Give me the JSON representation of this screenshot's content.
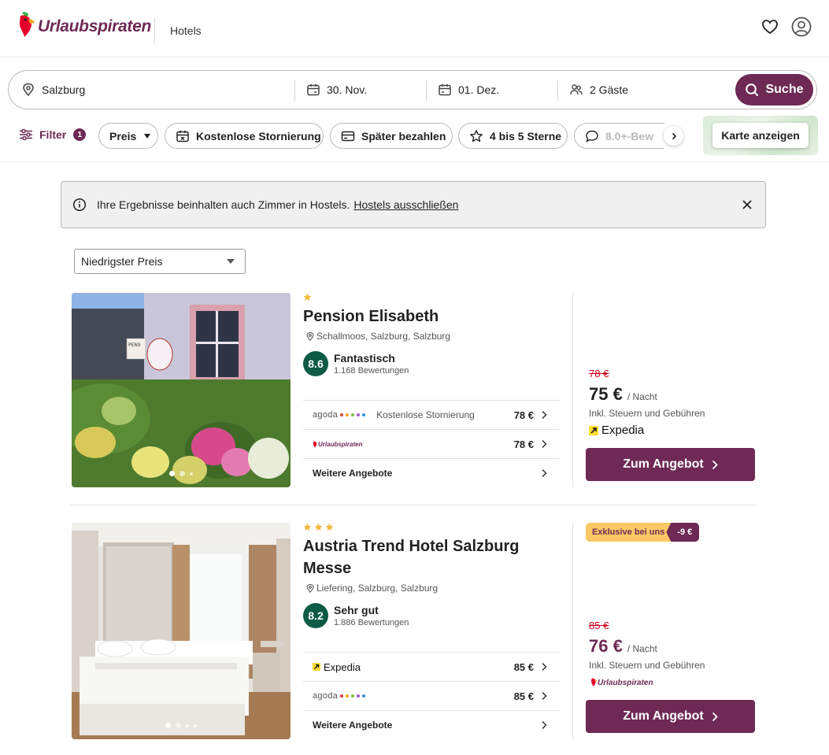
{
  "header": {
    "brand": "Urlaubspiraten",
    "section": "Hotels"
  },
  "search": {
    "destination": "Salzburg",
    "checkin": "30. Nov.",
    "checkout": "01. Dez.",
    "guests": "2 Gäste",
    "button": "Suche"
  },
  "filters": {
    "label": "Filter",
    "count": "1",
    "chips": [
      "Preis",
      "Kostenlose Stornierung",
      "Später bezahlen",
      "4 bis 5 Sterne",
      "8.0+-Bew"
    ],
    "map_button": "Karte anzeigen"
  },
  "info_banner": {
    "text": "Ihre Ergebnisse beinhalten auch Zimmer in Hostels.",
    "link": "Hostels ausschließen"
  },
  "sort": {
    "selected": "Niedrigster Preis"
  },
  "hotels": [
    {
      "name": "Pension Elisabeth",
      "stars": 1,
      "location": "Schallmoos, Salzburg, Salzburg",
      "score": "8.6",
      "rating_label": "Fantastisch",
      "reviews": "1.168 Bewertungen",
      "offers": [
        {
          "provider": "agoda",
          "note": "Kostenlose Stornierung",
          "price": "78 €"
        },
        {
          "provider": "Urlaubspiraten",
          "note": "",
          "price": "78 €"
        }
      ],
      "more_offers": "Weitere Angebote",
      "old_price": "78 €",
      "price": "75 €",
      "per_night": "/ Nacht",
      "taxes": "Inkl. Steuern und Gebühren",
      "best_provider": "Expedia",
      "cta": "Zum Angebot",
      "sign_text": "PENS"
    },
    {
      "name": "Austria Trend Hotel Salzburg Messe",
      "stars": 3,
      "location": "Liefering, Salzburg, Salzburg",
      "score": "8.2",
      "rating_label": "Sehr gut",
      "reviews": "1.886 Bewertungen",
      "offers": [
        {
          "provider": "Expedia",
          "note": "",
          "price": "85 €"
        },
        {
          "provider": "agoda",
          "note": "",
          "price": "85 €"
        }
      ],
      "more_offers": "Weitere Angebote",
      "exclusive_label": "Exklusive bei uns",
      "exclusive_discount": "-9 €",
      "old_price": "85 €",
      "price": "76 €",
      "per_night": "/ Nacht",
      "taxes": "Inkl. Steuern und Gebühren",
      "best_provider": "Urlaubspiraten",
      "cta": "Zum Angebot"
    }
  ],
  "colors": {
    "brand": "#6e2a55",
    "score": "#0d5a45",
    "old_price": "#d0021b",
    "exclusive": "#fcc865",
    "star": "#f5b83d"
  }
}
